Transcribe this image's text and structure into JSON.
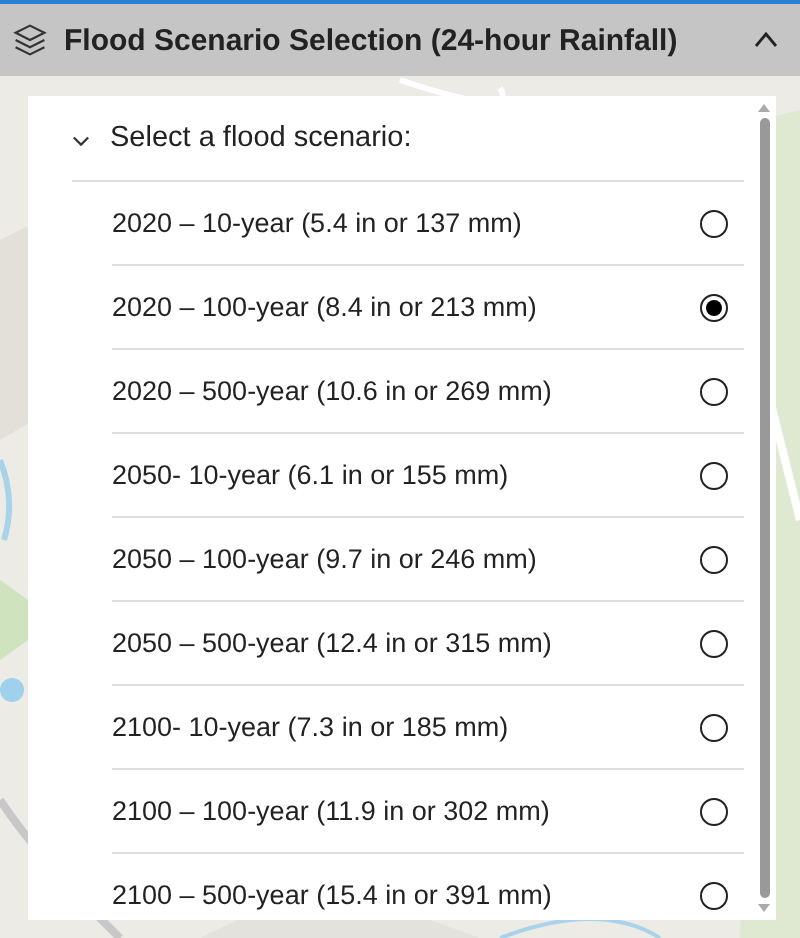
{
  "header": {
    "title": "Flood Scenario Selection (24-hour Rainfall)",
    "expanded": true
  },
  "section": {
    "title": "Select a flood scenario:",
    "expanded": true
  },
  "scenarios": [
    {
      "label": "2020 – 10-year (5.4 in or 137 mm)",
      "selected": false
    },
    {
      "label": "2020 – 100-year (8.4 in or 213 mm)",
      "selected": true
    },
    {
      "label": "2020 – 500-year (10.6 in or 269 mm)",
      "selected": false
    },
    {
      "label": "2050- 10-year (6.1 in or 155 mm)",
      "selected": false
    },
    {
      "label": "2050 – 100-year (9.7 in or 246 mm)",
      "selected": false
    },
    {
      "label": "2050 – 500-year (12.4 in or 315 mm)",
      "selected": false
    },
    {
      "label": "2100- 10-year (7.3 in or 185 mm)",
      "selected": false
    },
    {
      "label": "2100 – 100-year (11.9 in or 302 mm)",
      "selected": false
    },
    {
      "label": "2100 – 500-year (15.4 in or 391 mm)",
      "selected": false
    }
  ]
}
